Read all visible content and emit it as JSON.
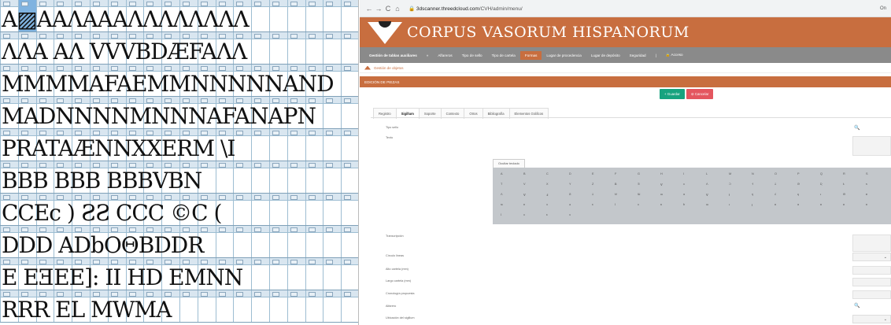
{
  "glyph_rows": [
    "A▨AAΛAAAΛΛΛΛΛΛΛΛ",
    "ΛΛA AΛ VVVBDÆFAΛΛ",
    "MMMMAFAEMMNNNNNAND",
    "MADNNNNMNNNAFANAPN",
    "PRATAÆNNXXERM  \\I",
    "BBB BBB BBBVBN",
    "CCEc ) ƧƧ CCC ©C (",
    "DDD  ADbOΘBDDR",
    "E EƎEE]: II HD EMNN",
    "RRR EL MWMA"
  ],
  "browser": {
    "url_host": "3dscanner.threedcloud.com",
    "url_path": "/CVH/admin/menu/",
    "ext": "On"
  },
  "header": {
    "title": "CORPUS VASORUM HISPANORUM"
  },
  "menu": {
    "items": [
      "Gestión de tablas auxiliares",
      "»",
      "Alfareros",
      "Tipo de sello",
      "Tipo de cartela",
      "Formas",
      "Lugar de procedencia",
      "Lugar de depósito",
      "Seguridad",
      "|",
      "🔒 Acceso"
    ],
    "active_index": 5
  },
  "crumb": "Gestión de objetos",
  "section": "EDICIÓN DE PIEZAS",
  "actions": {
    "save": "+ Guardar",
    "cancel": "⊘ Cancelar"
  },
  "tabs": [
    "Registro",
    "Sigillum",
    "Soporte",
    "Contexto",
    "Otros",
    "Bibliografía",
    "Elementos Gráficos"
  ],
  "active_tab": 1,
  "form": {
    "tipo_sello": "Tipo sello",
    "texto": "Texto",
    "ocultar": "Ocultar teclado",
    "transcripcion": "Transcripción",
    "circulo": "Círculo lineas",
    "alto": "Alto cartela (mm)",
    "largo": "Largo cartela (mm)",
    "cronologia": "Cronología propuesta",
    "alfarero": "Alfarero",
    "ubicacion": "Ubicación del sigillum"
  },
  "keyboard_rows": [
    [
      "A",
      "B",
      "C",
      "D",
      "E",
      "F",
      "G",
      "H",
      "I",
      "L",
      "M",
      "N",
      "O",
      "P",
      "Q",
      "R",
      "S"
    ],
    [
      "T",
      "V",
      "X",
      "Y",
      "Z",
      "Ƀ",
      "Ǝ",
      "Ɐ",
      "ʌ",
      "Ʌ",
      "Ɔ",
      "Ꟶ",
      "Ʇ",
      "Ə",
      "Ʀ",
      "Ƚ",
      "ƽ"
    ],
    [
      "Ʌ",
      "Ɐ",
      "Ⅎ",
      "Ƨ",
      "Ʇ",
      "Ʉ",
      "Ɯ",
      "ɯ",
      "ɑ",
      "Ɐ",
      "ɟ",
      "ʞ",
      "ʎ",
      "ɥ",
      "ɹ",
      "Ɵ",
      "ɐ"
    ],
    [
      "ʍ",
      "ɒ",
      "ɔ",
      "ə",
      "ɛ",
      "ʇ",
      "ʌ",
      "ʚ",
      "ɓ",
      "ɯ",
      "ɹ",
      "ɟ",
      "ʁ",
      "ɑ",
      "ʁ",
      "ʁ",
      "ɒ"
    ],
    [
      "ʇ",
      "ʌ",
      "ɛ",
      "ɔ"
    ]
  ],
  "colors": {
    "accent": "#c86e3f",
    "menu": "#8a8a8a",
    "save": "#17a37f",
    "cancel": "#e4565f"
  }
}
